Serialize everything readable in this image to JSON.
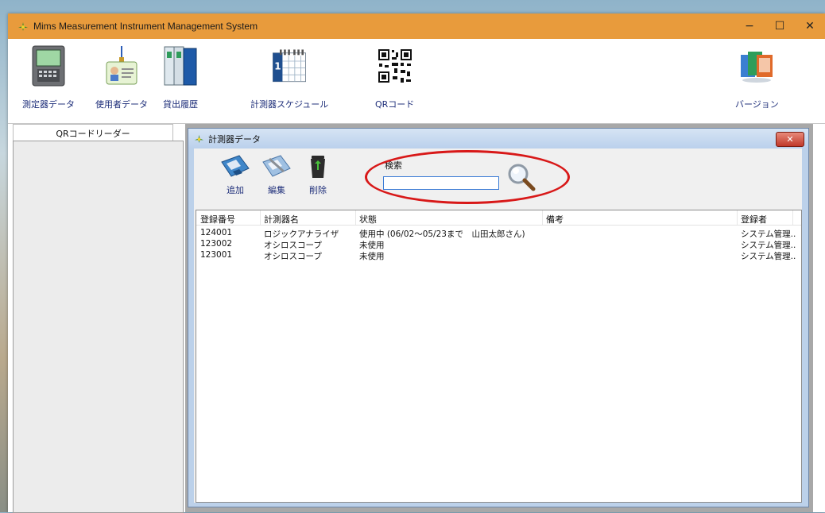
{
  "window": {
    "title": "Mims  Measurement Instrument Management System",
    "controls": {
      "minimize": "−",
      "maximize": "☐",
      "close": "✕"
    }
  },
  "toolbar": {
    "items": [
      {
        "label": "測定器データ",
        "icon": "measurement-device-icon"
      },
      {
        "label": "使用者データ",
        "icon": "id-card-icon"
      },
      {
        "label": "貸出履歴",
        "icon": "binders-icon"
      },
      {
        "label": "計測器スケジュール",
        "icon": "calendar-icon"
      },
      {
        "label": "QRコード",
        "icon": "qr-code-icon"
      },
      {
        "label": "バージョン",
        "icon": "office-apps-icon"
      }
    ]
  },
  "left_panel": {
    "tab_label": "QRコードリーダー"
  },
  "child_window": {
    "title": "計測器データ",
    "close_label": "✕",
    "actions": {
      "add": "追加",
      "edit": "編集",
      "delete": "削除"
    },
    "search": {
      "label": "検索",
      "value": "",
      "placeholder": ""
    },
    "table": {
      "headers": [
        "登録番号",
        "計測器名",
        "状態",
        "備考",
        "登録者"
      ],
      "rows": [
        [
          "124001",
          "ロジックアナライザ",
          "使用中 (06/02～05/23まで　山田太郎さん)",
          "",
          "システム管理.."
        ],
        [
          "123002",
          "オシロスコープ",
          "未使用",
          "",
          "システム管理.."
        ],
        [
          "123001",
          "オシロスコープ",
          "未使用",
          "",
          "システム管理.."
        ]
      ]
    }
  },
  "colors": {
    "titlebar": "#e89b3c",
    "highlight_ellipse": "#d81818",
    "link_text": "#1f2f7a"
  }
}
